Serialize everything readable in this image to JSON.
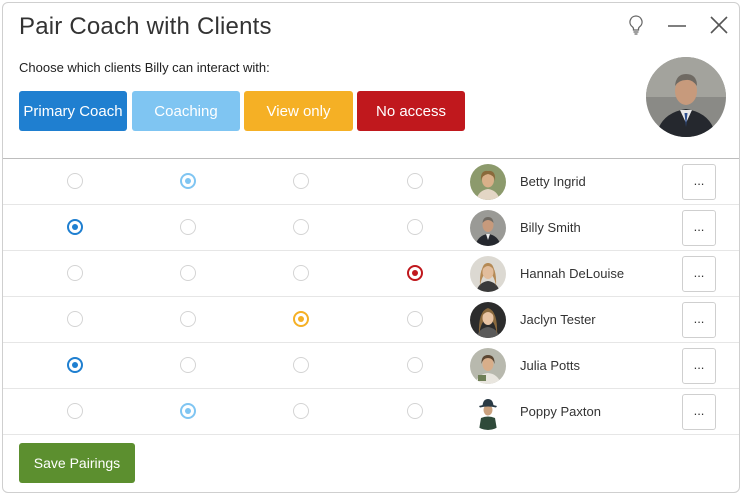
{
  "dialog": {
    "title": "Pair Coach with Clients",
    "subtitle": "Choose which clients Billy can interact with:",
    "controls": {
      "hint_icon": "lightbulb-icon",
      "minimize_icon": "minimize-icon",
      "close_icon": "close-icon"
    }
  },
  "permissions": [
    {
      "key": "primary",
      "label": "Primary Coach",
      "color": "#1f7fd0"
    },
    {
      "key": "coaching",
      "label": "Coaching",
      "color": "#7fc5f2"
    },
    {
      "key": "view",
      "label": "View only",
      "color": "#f5b025"
    },
    {
      "key": "noaccess",
      "label": "No access",
      "color": "#c0181d"
    }
  ],
  "clients": [
    {
      "name": "Betty Ingrid",
      "selected": "coaching",
      "more_label": "..."
    },
    {
      "name": "Billy Smith",
      "selected": "primary",
      "more_label": "..."
    },
    {
      "name": "Hannah DeLouise",
      "selected": "noaccess",
      "more_label": "..."
    },
    {
      "name": "Jaclyn Tester",
      "selected": "view",
      "more_label": "..."
    },
    {
      "name": "Julia Potts",
      "selected": "primary",
      "more_label": "..."
    },
    {
      "name": "Poppy Paxton",
      "selected": "coaching",
      "more_label": "..."
    }
  ],
  "footer": {
    "save_label": "Save Pairings"
  }
}
